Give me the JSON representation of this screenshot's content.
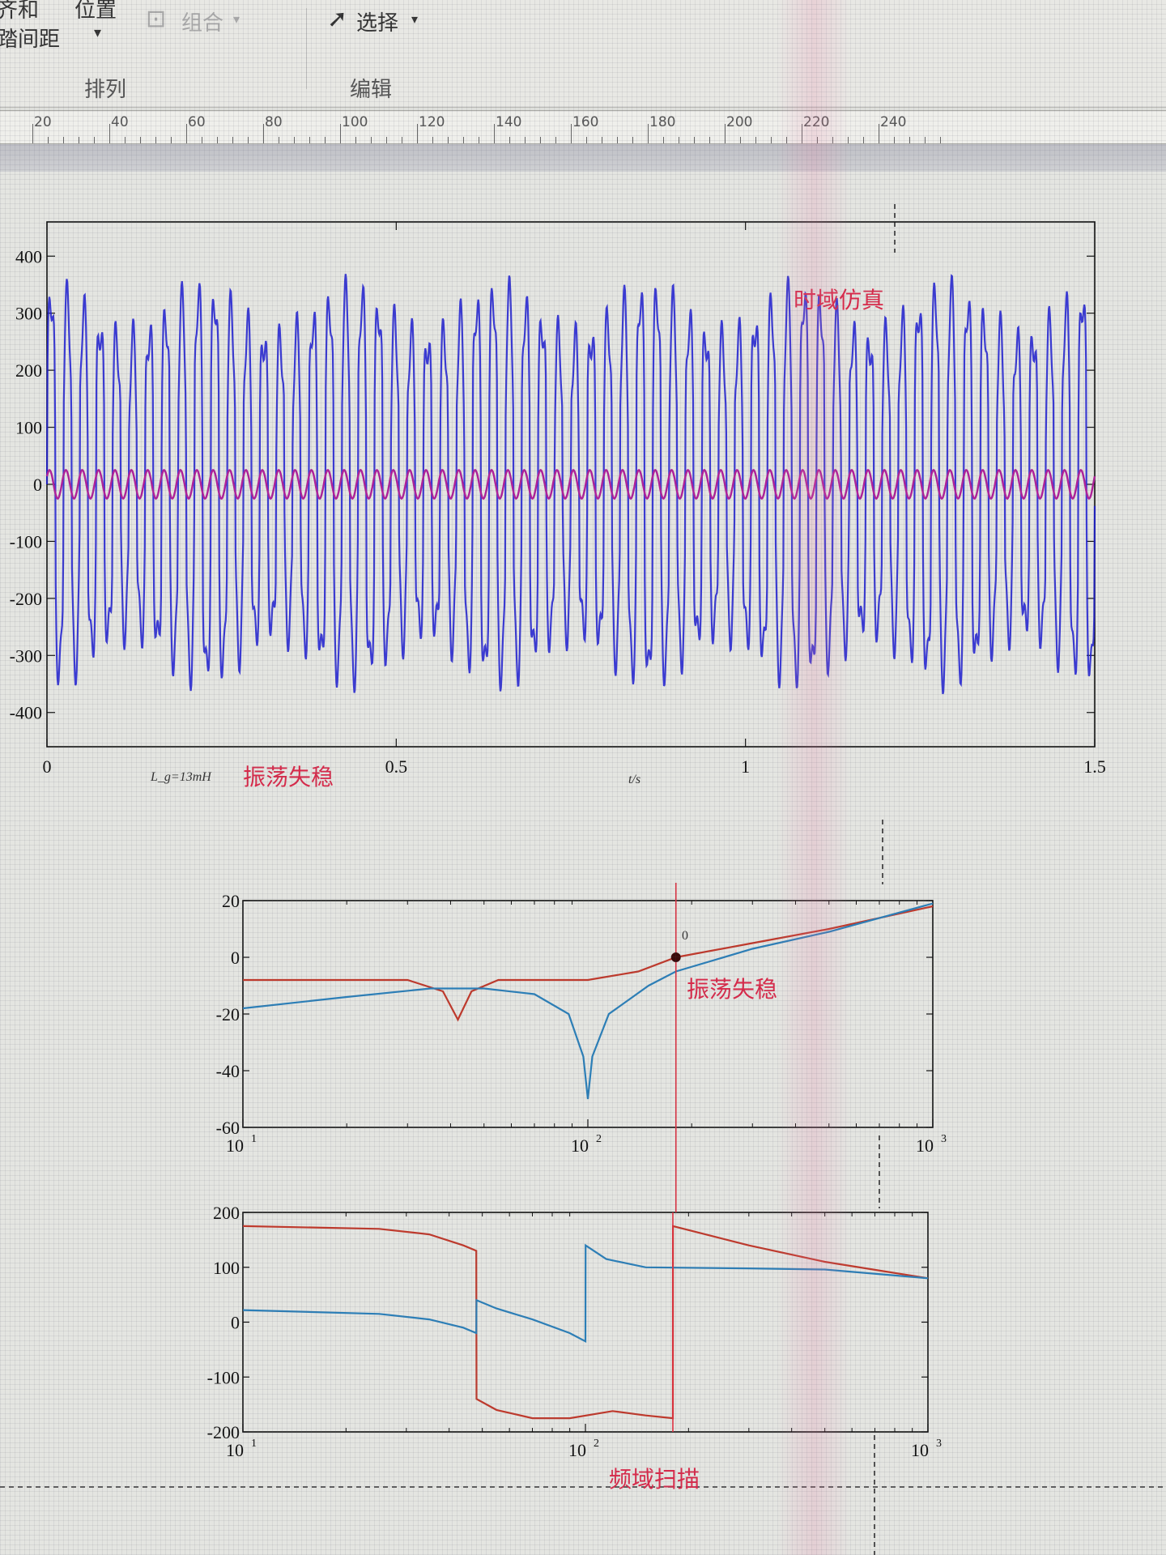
{
  "ribbon": {
    "align_partial": "齐和",
    "spacing_partial": "踏间距",
    "position_label": "位置",
    "group_label": "组合",
    "select_label": "选择",
    "arrange_group": "排列",
    "edit_group": "编辑"
  },
  "ruler": {
    "marks": [
      "20",
      "40",
      "60",
      "80",
      "100",
      "120",
      "140",
      "160",
      "180",
      "200",
      "220",
      "240"
    ]
  },
  "time_plot": {
    "title_annotation": "时域仿真",
    "status_annotation": "振荡失稳",
    "param_annotation": "L_g=13mH",
    "x_axis_label": "t/s",
    "colors": {
      "signal_a": "#1c1cd0",
      "signal_b": "#b0209a"
    }
  },
  "bode": {
    "magnitude_annotation": "振荡失稳",
    "marker_label": "0",
    "bottom_annotation": "频域扫描",
    "colors": {
      "curve_red": "#c0392b",
      "curve_blue": "#2b7fb8",
      "cursor": "#e03040"
    }
  },
  "chart_data": [
    {
      "type": "line",
      "title": "",
      "xlabel": "t/s",
      "ylabel": "",
      "xlim": [
        0,
        1.5
      ],
      "ylim": [
        -460,
        460
      ],
      "x_ticks": [
        "0",
        "0.5",
        "1",
        "1.5"
      ],
      "y_ticks": [
        "400",
        "300",
        "200",
        "100",
        "0",
        "-100",
        "-200",
        "-300",
        "-400"
      ],
      "series": [
        {
          "amplitude": 330,
          "oscillation_cycles": 64,
          "color": "#1c1cd0"
        },
        {
          "amplitude": 25,
          "oscillation_cycles": 64,
          "color": "#b0209a"
        }
      ]
    },
    {
      "type": "line",
      "title": "",
      "x_scale": "log",
      "xlim": [
        10,
        1000
      ],
      "ylim": [
        -60,
        20
      ],
      "x_ticks": [
        "10",
        "10",
        "10"
      ],
      "x_tick_exponents": [
        "1",
        "2",
        "3"
      ],
      "y_ticks": [
        "20",
        "0",
        "-20",
        "-40",
        "-60"
      ],
      "series": [
        {
          "color": "#c0392b",
          "points": [
            [
              10,
              -8
            ],
            [
              30,
              -8
            ],
            [
              38,
              -12
            ],
            [
              42,
              -22
            ],
            [
              46,
              -12
            ],
            [
              55,
              -8
            ],
            [
              100,
              -8
            ],
            [
              140,
              -5
            ],
            [
              180,
              0
            ],
            [
              300,
              5
            ],
            [
              500,
              10
            ],
            [
              1000,
              18
            ]
          ]
        },
        {
          "color": "#2b7fb8",
          "points": [
            [
              10,
              -18
            ],
            [
              20,
              -14
            ],
            [
              35,
              -11
            ],
            [
              50,
              -11
            ],
            [
              70,
              -13
            ],
            [
              88,
              -20
            ],
            [
              97,
              -35
            ],
            [
              100,
              -50
            ],
            [
              103,
              -35
            ],
            [
              115,
              -20
            ],
            [
              150,
              -10
            ],
            [
              180,
              -5
            ],
            [
              300,
              3
            ],
            [
              500,
              9
            ],
            [
              1000,
              19
            ]
          ]
        }
      ],
      "marker": {
        "x": 180,
        "y": 0
      },
      "cursor_x": 180
    },
    {
      "type": "line",
      "title": "",
      "x_scale": "log",
      "xlim": [
        10,
        1000
      ],
      "ylim": [
        -200,
        200
      ],
      "x_ticks": [
        "10",
        "10",
        "10"
      ],
      "x_tick_exponents": [
        "1",
        "2",
        "3"
      ],
      "y_ticks": [
        "200",
        "100",
        "0",
        "-100",
        "-200"
      ],
      "series": [
        {
          "color": "#c0392b",
          "points": [
            [
              10,
              175
            ],
            [
              25,
              170
            ],
            [
              35,
              160
            ],
            [
              44,
              140
            ],
            [
              48,
              130
            ],
            [
              48.1,
              -140
            ],
            [
              55,
              -160
            ],
            [
              70,
              -175
            ],
            [
              90,
              -175
            ],
            [
              120,
              -162
            ],
            [
              150,
              -170
            ],
            [
              180,
              -175
            ],
            [
              180.1,
              175
            ],
            [
              300,
              140
            ],
            [
              500,
              110
            ],
            [
              1000,
              80
            ]
          ]
        },
        {
          "color": "#2b7fb8",
          "points": [
            [
              10,
              22
            ],
            [
              25,
              15
            ],
            [
              35,
              5
            ],
            [
              44,
              -10
            ],
            [
              48,
              -20
            ],
            [
              48.1,
              40
            ],
            [
              55,
              25
            ],
            [
              70,
              5
            ],
            [
              90,
              -20
            ],
            [
              100,
              -35
            ],
            [
              100.1,
              140
            ],
            [
              115,
              115
            ],
            [
              150,
              100
            ],
            [
              300,
              98
            ],
            [
              500,
              96
            ],
            [
              1000,
              80
            ]
          ]
        }
      ],
      "cursor_x": 180
    }
  ]
}
